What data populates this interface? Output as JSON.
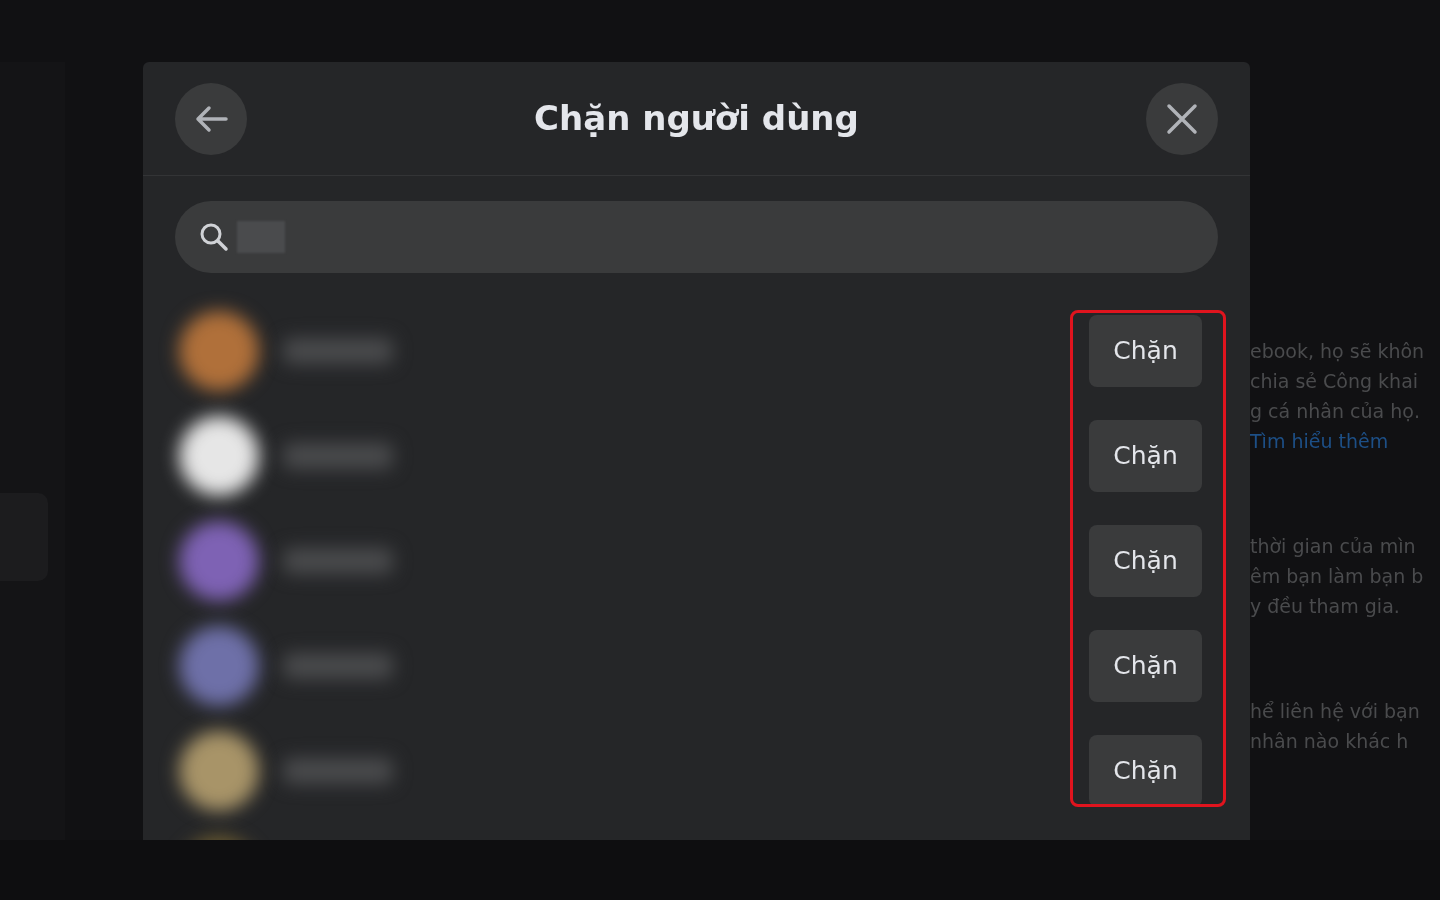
{
  "background": {
    "paragraphs": [
      {
        "lines": [
          "ebook, họ sẽ khôn",
          "chia sẻ Công khai",
          "g cá nhân của họ."
        ],
        "link": "Tìm hiểu thêm"
      },
      {
        "lines": [
          "thời gian của mìn",
          "êm bạn làm bạn b",
          "y đều tham gia."
        ]
      },
      {
        "lines": [
          "hể liên hệ với bạn",
          "nhân nào khác h"
        ]
      }
    ]
  },
  "dialog": {
    "title": "Chặn người dùng",
    "search": {
      "redacted": true
    },
    "rows": [
      {
        "color": "#b0703a",
        "button": "Chặn"
      },
      {
        "color": "#e6e6e6",
        "button": "Chặn"
      },
      {
        "color": "#7e62b4",
        "button": "Chặn"
      },
      {
        "color": "#6e70a8",
        "button": "Chặn"
      },
      {
        "color": "#a89468",
        "button": "Chặn"
      }
    ],
    "highlight": true
  }
}
